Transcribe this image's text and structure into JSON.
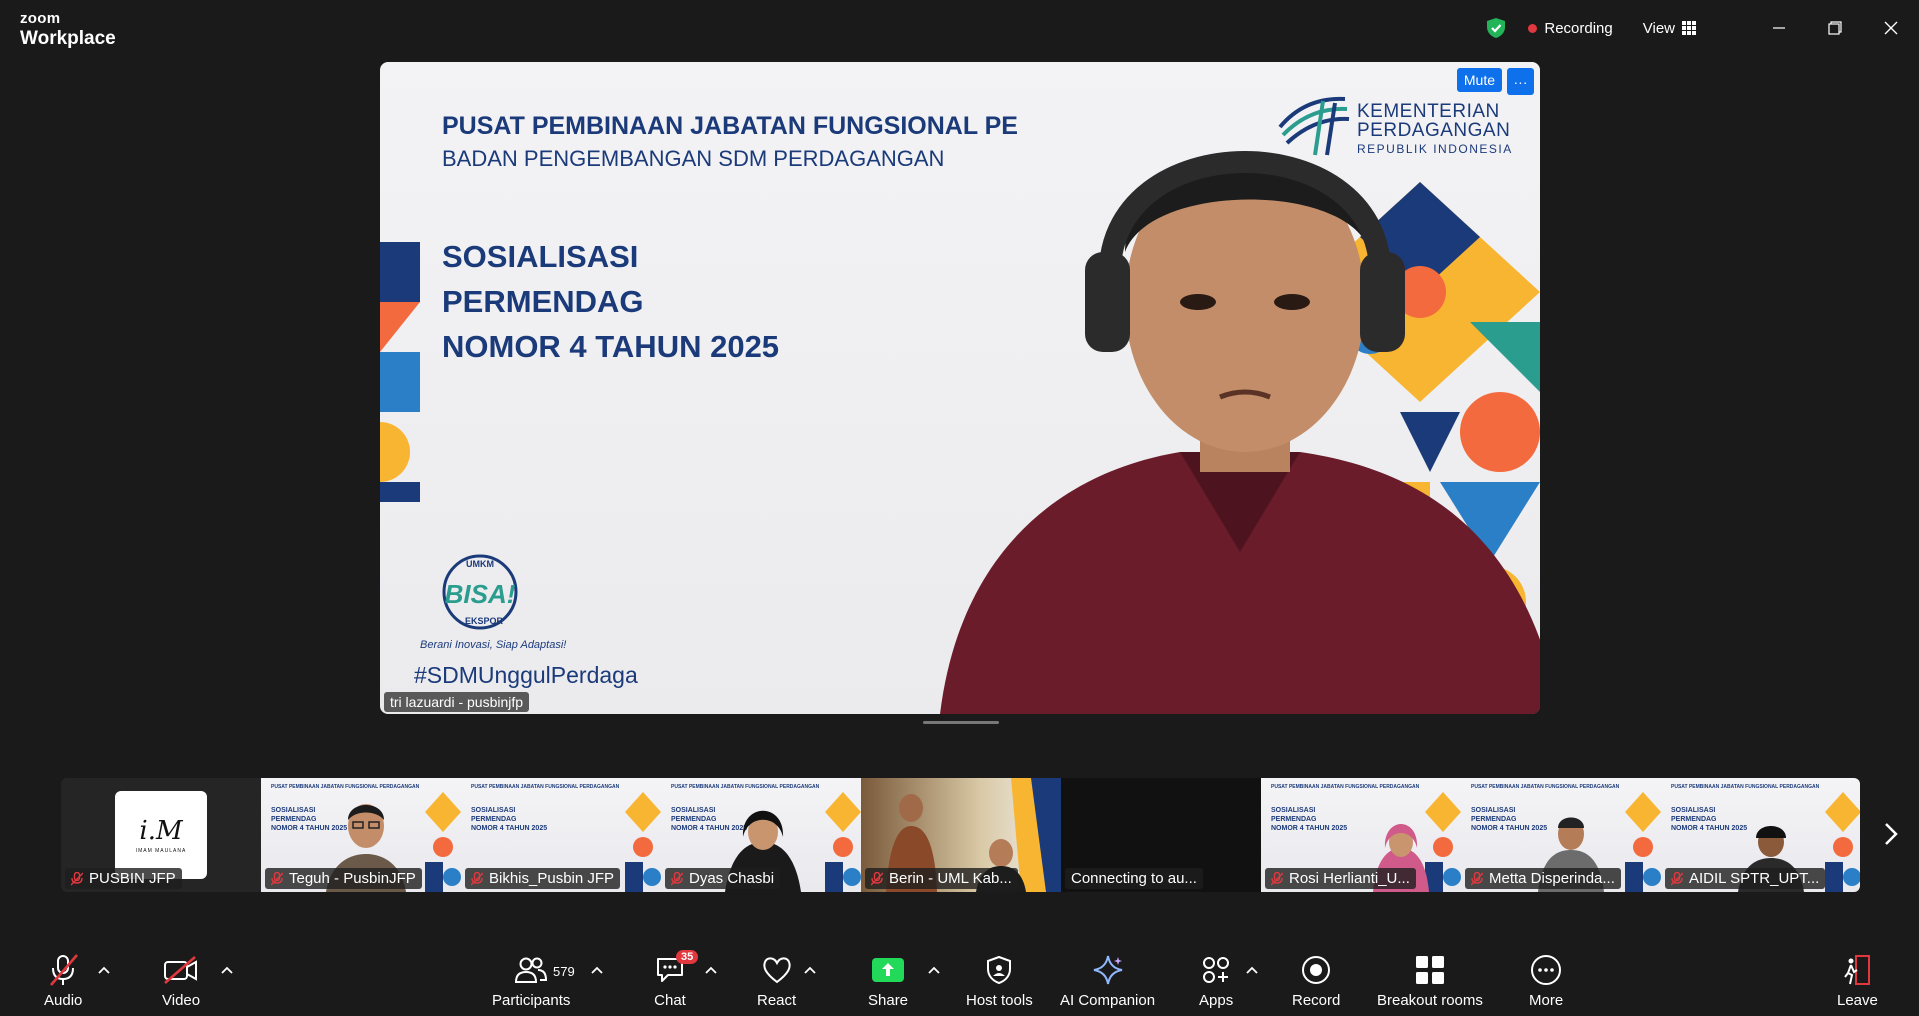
{
  "app": {
    "brand_top": "zoom",
    "brand_bottom": "Workplace"
  },
  "titlebar": {
    "recording_label": "Recording",
    "view_label": "View"
  },
  "speaker": {
    "name": "tri lazuardi - pusbinjfp",
    "mute_label": "Mute",
    "more_label": "···",
    "slide": {
      "line1": "PUSAT PEMBINAAN JABATAN FUNGSIONAL PE",
      "line2": "BADAN PENGEMBANGAN SDM PERDAGANGAN",
      "title1": "SOSIALISASI",
      "title2": "PERMENDAG",
      "title3": "NOMOR 4 TAHUN 2025",
      "logo1": "KEMENTERIAN",
      "logo2": "PERDAGANGAN",
      "logo3": "REPUBLIK INDONESIA",
      "hashtag": "#SDMUnggulPerdaga",
      "umkm_top": "UMKM",
      "umkm_mid": "BISA!",
      "umkm_bottom": "EKSPOR",
      "tagline": "Berani Inovasi, Siap Adaptasi!"
    }
  },
  "gallery": [
    {
      "name": "PUSBIN JFP",
      "kind": "logo",
      "logo_big": "i.M",
      "logo_small": "IMAM MAULANA"
    },
    {
      "name": "Teguh - PusbinJFP",
      "kind": "slide-person"
    },
    {
      "name": "Bikhis_Pusbin JFP",
      "kind": "slide"
    },
    {
      "name": "Dyas Chasbi",
      "kind": "slide-person"
    },
    {
      "name": "Berin - UML Kab...",
      "kind": "room"
    },
    {
      "name": "Connecting to au...",
      "kind": "dark"
    },
    {
      "name": "Rosi Herlianti_U...",
      "kind": "slide-person"
    },
    {
      "name": "Metta Disperinda...",
      "kind": "slide-person"
    },
    {
      "name": "AIDIL SPTR_UPT...",
      "kind": "slide-person"
    }
  ],
  "mini_slide": {
    "l1": "PUSAT PEMBINAAN JABATAN FUNGSIONAL PERDAGANGAN",
    "l2": "SOSIALISASI",
    "l3": "PERMENDAG",
    "l4": "NOMOR 4 TAHUN 2025"
  },
  "toolbar": {
    "audio": "Audio",
    "video": "Video",
    "participants": "Participants",
    "participants_count": "579",
    "chat": "Chat",
    "chat_badge": "35",
    "react": "React",
    "share": "Share",
    "host_tools": "Host tools",
    "ai_companion": "AI Companion",
    "apps": "Apps",
    "record": "Record",
    "breakout_rooms": "Breakout rooms",
    "more": "More",
    "leave": "Leave"
  },
  "colors": {
    "accent": "#0e71eb",
    "recording": "#e0383e",
    "share": "#23d959",
    "slide_navy": "#1b3a7a"
  }
}
